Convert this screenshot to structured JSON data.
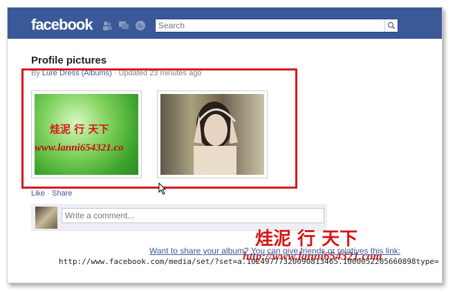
{
  "header": {
    "logo_text": "facebook",
    "search_placeholder": "Search",
    "icons": [
      "friends-icon",
      "messages-icon",
      "notifications-globe-icon",
      "search-icon"
    ],
    "brand_color": "#3b5998"
  },
  "album": {
    "title": "Profile pictures",
    "by_prefix": "By",
    "author_link": "Lure Dress (Albums)",
    "updated": "Updated 23 minutes ago"
  },
  "photos": [
    {
      "name": "green-photo"
    },
    {
      "name": "headphones-girl-photo"
    }
  ],
  "watermark": {
    "chinese": "烓泥 行 天下",
    "url_small": "www.lanni654321.co",
    "url_large": "http://www.lanni654321.com"
  },
  "actions": {
    "like": "Like",
    "separator": "·",
    "share": "Share"
  },
  "comment": {
    "placeholder": "Write a comment..."
  },
  "share_info": {
    "line1": "Want to share your album? You can give friends or relatives this link:",
    "line2": "http://www.facebook.com/media/set/?set=a.10249777320090813465.1000052205660898type="
  },
  "highlight_color": "#d6161d"
}
